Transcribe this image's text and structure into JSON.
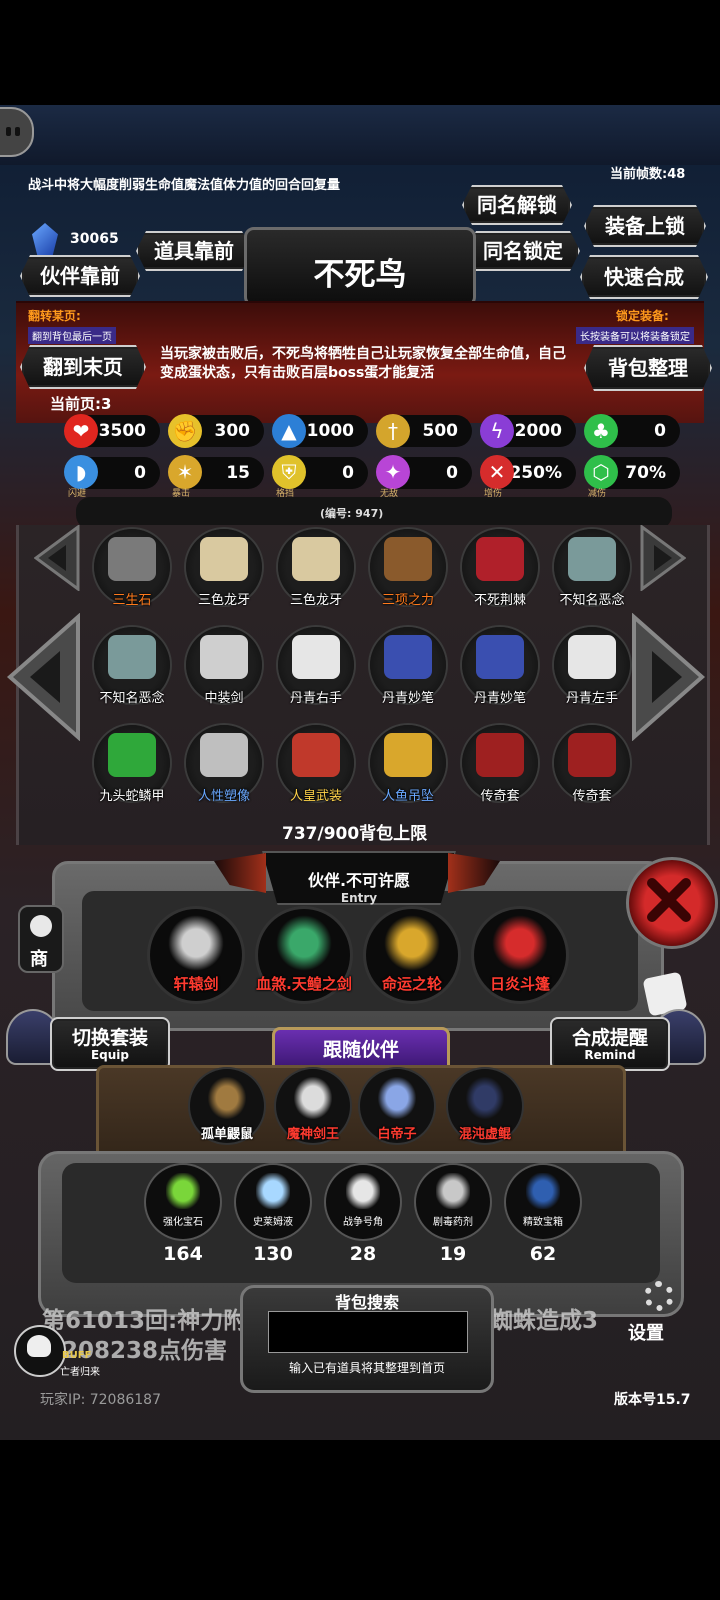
{
  "header": {
    "description": "战斗中将大幅度削弱生命值魔法值体力值的回合回复量",
    "fps": "当前帧数:48",
    "gem_count": "30065"
  },
  "top_buttons": {
    "same_unlock": "同名解锁",
    "equip_lock": "装备上锁",
    "item_front": "道具靠前",
    "same_lock": "同名锁定",
    "partner_front": "伙伴靠前",
    "quick_synth": "快速合成",
    "last_page": "翻到末页",
    "organize": "背包整理"
  },
  "item_title": "不死鸟",
  "flip": {
    "label": "翻转某页:",
    "hint": "翻到背包最后一页"
  },
  "lock": {
    "label": "锁定装备:",
    "hint": "长按装备可以将装备锁定"
  },
  "item_desc": "当玩家被击败后，不死鸟将牺牲自己让玩家恢复全部生命值，自己变成蛋状态，只有击败百层boss蛋才能复活",
  "current_page": "当前页:3",
  "stats_row1": [
    {
      "icon": "heart-icon",
      "value": "3500",
      "color": "#e0261f"
    },
    {
      "icon": "strength-icon",
      "value": "300",
      "color": "#e7c12b"
    },
    {
      "icon": "boot-icon",
      "value": "1000",
      "color": "#2c7fd6"
    },
    {
      "icon": "sword-icon",
      "value": "500",
      "color": "#d4a52c"
    },
    {
      "icon": "lightning-icon",
      "value": "2000",
      "color": "#8a3dd6"
    },
    {
      "icon": "clover-icon",
      "value": "0",
      "color": "#2fbf4a"
    }
  ],
  "stats_row2": [
    {
      "icon": "dodge-icon",
      "value": "0",
      "label": "闪避",
      "color": "#3a8fe0"
    },
    {
      "icon": "crit-icon",
      "value": "15",
      "label": "暴击",
      "color": "#d9a72c"
    },
    {
      "icon": "block-icon",
      "value": "0",
      "label": "格挡",
      "color": "#e0c22b"
    },
    {
      "icon": "invincible-icon",
      "value": "0",
      "label": "无敌",
      "color": "#b845d6"
    },
    {
      "icon": "damage-up-icon",
      "value": "250%",
      "label": "增伤",
      "color": "#d62c2c"
    },
    {
      "icon": "damage-down-icon",
      "value": "70%",
      "label": "减伤",
      "color": "#2fbf4a"
    }
  ],
  "item_number": "(编号: 947)",
  "inventory": [
    {
      "name": "三生石",
      "color": "#7a7a7a",
      "name_color": "#ff7a1c"
    },
    {
      "name": "三色龙牙",
      "color": "#d9c9a0",
      "name_color": "#ffffff"
    },
    {
      "name": "三色龙牙",
      "color": "#d9c9a0",
      "name_color": "#ffffff"
    },
    {
      "name": "三项之力",
      "color": "#8a5a2c",
      "name_color": "#ff7a1c"
    },
    {
      "name": "不死荆棘",
      "color": "#b0202a",
      "name_color": "#ffffff"
    },
    {
      "name": "不知名恶念",
      "color": "#7a9a9a",
      "name_color": "#ffffff"
    },
    {
      "name": "不知名恶念",
      "color": "#7a9a9a",
      "name_color": "#ffffff"
    },
    {
      "name": "中装剑",
      "color": "#cfcfcf",
      "name_color": "#ffffff"
    },
    {
      "name": "丹青右手",
      "color": "#e6e6e6",
      "name_color": "#ffffff"
    },
    {
      "name": "丹青妙笔",
      "color": "#3a4fb0",
      "name_color": "#ffffff"
    },
    {
      "name": "丹青妙笔",
      "color": "#3a4fb0",
      "name_color": "#ffffff"
    },
    {
      "name": "丹青左手",
      "color": "#e6e6e6",
      "name_color": "#ffffff"
    },
    {
      "name": "九头蛇鳞甲",
      "color": "#2fa83a",
      "name_color": "#ffffff"
    },
    {
      "name": "人性塑像",
      "color": "#bfbfbf",
      "name_color": "#6aa8ff"
    },
    {
      "name": "人皇武装",
      "color": "#c0392b",
      "name_color": "#ffd24a"
    },
    {
      "name": "人鱼吊坠",
      "color": "#d9a72c",
      "name_color": "#6aa8ff"
    },
    {
      "name": "传奇套",
      "color": "#9e2020",
      "name_color": "#ffffff"
    },
    {
      "name": "传奇套",
      "color": "#9e2020",
      "name_color": "#ffffff"
    }
  ],
  "bag_limit": "737/900背包上限",
  "entry": {
    "title": "伙伴.不可许愿",
    "sub": "Entry"
  },
  "equipped": [
    {
      "name": "轩辕剑",
      "color": "#cfcfcf"
    },
    {
      "name": "血煞.天鳇之剑",
      "color": "#3aa86a"
    },
    {
      "name": "命运之轮",
      "color": "#d9a72c"
    },
    {
      "name": "日炎斗篷",
      "color": "#d62c2c"
    }
  ],
  "switch_set": {
    "label": "切换套装",
    "sub": "Equip"
  },
  "synth_remind": {
    "label": "合成提醒",
    "sub": "Remind"
  },
  "follow_partner": "跟随伙伴",
  "partners": [
    {
      "name": "孤单鼹鼠",
      "name_color": "#ffffff",
      "color": "#a07a40"
    },
    {
      "name": "魔神剑王",
      "name_color": "#ff3b30",
      "color": "#dcdcdc"
    },
    {
      "name": "白帝子",
      "name_color": "#ff3b30",
      "color": "#8aa6e6"
    },
    {
      "name": "混沌虚鲲",
      "name_color": "#ff3b30",
      "color": "#303b66"
    }
  ],
  "consumables": [
    {
      "name": "强化宝石",
      "count": "164",
      "color": "#7ad63a"
    },
    {
      "name": "史莱姆液",
      "count": "130",
      "color": "#a8d8ff"
    },
    {
      "name": "战争号角",
      "count": "28",
      "color": "#e6e6e6"
    },
    {
      "name": "剧毒药剂",
      "count": "19",
      "color": "#c8c8c8"
    },
    {
      "name": "精致宝箱",
      "count": "62",
      "color": "#2f5fb0"
    }
  ],
  "bottom": {
    "log_line1a": "第61013回:神力附",
    "log_line1b": "蜘蛛造成3",
    "log_line2": "208238点伤害",
    "search_title": "背包搜索",
    "search_hint": "输入已有道具将其整理到首页",
    "buff": "BUFF",
    "buff_sub": "亡者归来",
    "player_ip": "玩家IP:  72086187",
    "version": "版本号15.7",
    "settings": "设置",
    "shop": "商"
  }
}
